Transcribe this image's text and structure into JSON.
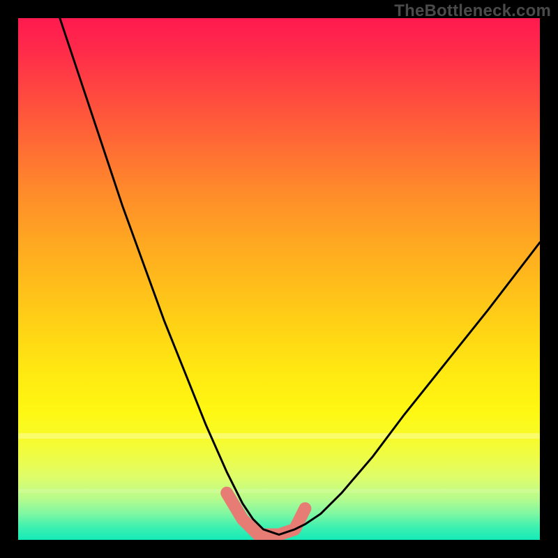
{
  "watermark": "TheBottleneck.com",
  "colors": {
    "frame": "#000000",
    "curve_stroke": "#000000",
    "marker_stroke": "#e77c75",
    "gradient_top": "#ff1a4f",
    "gradient_bottom": "#14eab7"
  },
  "chart_data": {
    "type": "line",
    "title": "",
    "xlabel": "",
    "ylabel": "",
    "xlim": [
      0,
      100
    ],
    "ylim": [
      0,
      100
    ],
    "series": [
      {
        "name": "bottleneck-curve",
        "x": [
          8,
          12,
          16,
          20,
          24,
          28,
          32,
          36,
          40,
          43,
          45,
          47,
          50,
          53,
          55,
          58,
          62,
          68,
          74,
          82,
          90,
          100
        ],
        "y": [
          100,
          88,
          76,
          64,
          53,
          42,
          32,
          22,
          13,
          7,
          4,
          2,
          1,
          2,
          3,
          5,
          9,
          16,
          24,
          34,
          44,
          57
        ]
      }
    ],
    "markers": {
      "name": "highlighted-min",
      "x": [
        40,
        43,
        46,
        50,
        53,
        55
      ],
      "y": [
        9,
        4,
        1,
        1,
        2,
        6
      ]
    }
  }
}
